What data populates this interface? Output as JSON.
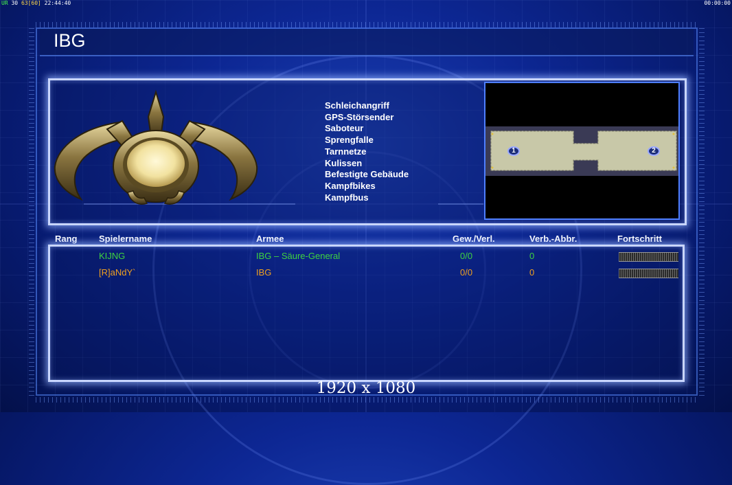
{
  "debug": {
    "prefix": "UR",
    "fps": "30",
    "fps_alt": "63",
    "fps_cap": "[60]",
    "clock": "22:44:40",
    "timer": "00:00:00"
  },
  "screen": {
    "title": "IBG"
  },
  "rules": [
    "Schleichangriff",
    "GPS-Störsender",
    "Saboteur",
    "Sprengfalle",
    "Tarnnetze",
    "Kulissen",
    "Befestigte Gebäude",
    "Kampfbikes",
    "Kampfbus"
  ],
  "minimap": {
    "start_positions": [
      "1",
      "2"
    ]
  },
  "table": {
    "headers": {
      "rank": "Rang",
      "player": "Spielername",
      "army": "Armee",
      "winloss": "Gew./Verl.",
      "disconnect": "Verb.-Abbr.",
      "progress": "Fortschritt"
    },
    "rows": [
      {
        "name": "KIJNG",
        "army": "IBG – Säure-General",
        "winloss": "0/0",
        "disconnect": "0",
        "color": "#3fd43f"
      },
      {
        "name": "[R]aNdY`",
        "army": "IBG",
        "winloss": "0/0",
        "disconnect": "0",
        "color": "#f0a020"
      }
    ]
  },
  "footer": {
    "resolution": "1920 x 1080"
  },
  "colors": {
    "panel_border": "#c9d6ff",
    "minimap_border": "#4f7fff",
    "player1": "#3fd43f",
    "player2": "#f0a020"
  }
}
